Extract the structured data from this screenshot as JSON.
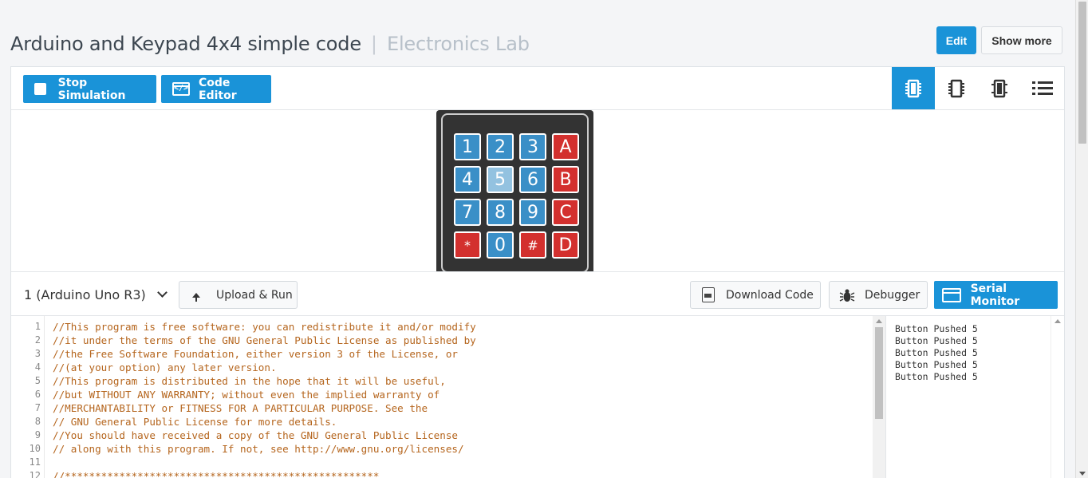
{
  "header": {
    "title": "Arduino and Keypad 4x4 simple code",
    "separator": "|",
    "subtitle": "Electronics Lab",
    "edit_label": "Edit",
    "show_more_label": "Show more"
  },
  "toolbar": {
    "stop_label": "Stop Simulation",
    "code_editor_label": "Code Editor",
    "views": [
      "component-view-icon",
      "schematic-view-icon",
      "chip-view-icon",
      "list-view-icon"
    ],
    "active_view": 0
  },
  "keypad": {
    "rows": [
      [
        {
          "label": "1",
          "kind": "num"
        },
        {
          "label": "2",
          "kind": "num"
        },
        {
          "label": "3",
          "kind": "num"
        },
        {
          "label": "A",
          "kind": "let"
        }
      ],
      [
        {
          "label": "4",
          "kind": "num"
        },
        {
          "label": "5",
          "kind": "num",
          "pressed": true
        },
        {
          "label": "6",
          "kind": "num"
        },
        {
          "label": "B",
          "kind": "let"
        }
      ],
      [
        {
          "label": "7",
          "kind": "num"
        },
        {
          "label": "8",
          "kind": "num"
        },
        {
          "label": "9",
          "kind": "num"
        },
        {
          "label": "C",
          "kind": "let"
        }
      ],
      [
        {
          "label": "*",
          "kind": "let"
        },
        {
          "label": "0",
          "kind": "num"
        },
        {
          "label": "#",
          "kind": "let"
        },
        {
          "label": "D",
          "kind": "let"
        }
      ]
    ]
  },
  "lower": {
    "board_select": "1 (Arduino Uno R3)",
    "upload_label": "Upload & Run",
    "download_label": "Download Code",
    "debugger_label": "Debugger",
    "serial_label": "Serial Monitor"
  },
  "code": {
    "lines": [
      "//This program is free software: you can redistribute it and/or modify",
      "//it under the terms of the GNU General Public License as published by",
      "//the Free Software Foundation, either version 3 of the License, or",
      "//(at your option) any later version.",
      "//This program is distributed in the hope that it will be useful,",
      "//but WITHOUT ANY WARRANTY; without even the implied warranty of",
      "//MERCHANTABILITY or FITNESS FOR A PARTICULAR PURPOSE. See the",
      "// GNU General Public License for more details.",
      "//You should have received a copy of the GNU General Public License",
      "// along with this program. If not, see http://www.gnu.org/licenses/",
      "",
      "//****************************************************"
    ],
    "line_numbers": [
      "1",
      "2",
      "3",
      "4",
      "5",
      "6",
      "7",
      "8",
      "9",
      "10",
      "11",
      "12"
    ]
  },
  "serial": {
    "lines": [
      "Button Pushed 5",
      "Button Pushed 5",
      "Button Pushed 5",
      "Button Pushed 5",
      "Button Pushed 5"
    ]
  },
  "colors": {
    "accent": "#1a93d8",
    "key_number": "#3a8fc7",
    "key_letter": "#d3302e",
    "code_comment": "#b5651d"
  }
}
